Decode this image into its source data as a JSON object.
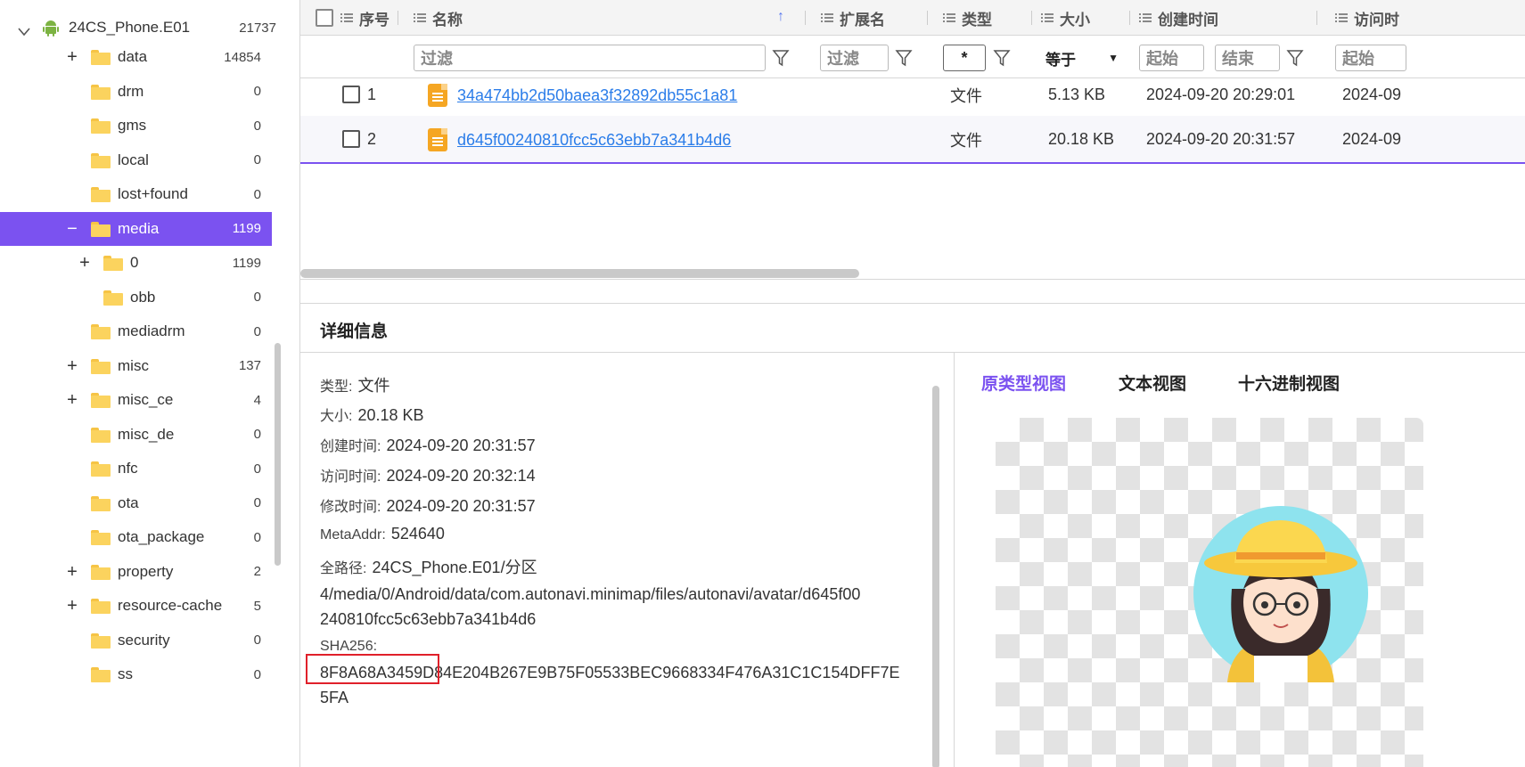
{
  "tree": {
    "root": {
      "label": "24CS_Phone.E01",
      "count": "21737"
    },
    "items": [
      {
        "label": "data",
        "count": "14854",
        "expander": "+"
      },
      {
        "label": "drm",
        "count": "0",
        "expander": ""
      },
      {
        "label": "gms",
        "count": "0",
        "expander": ""
      },
      {
        "label": "local",
        "count": "0",
        "expander": ""
      },
      {
        "label": "lost+found",
        "count": "0",
        "expander": ""
      },
      {
        "label": "media",
        "count": "1199",
        "expander": "−"
      },
      {
        "label": "0",
        "count": "1199",
        "expander": "+"
      },
      {
        "label": "obb",
        "count": "0",
        "expander": ""
      },
      {
        "label": "mediadrm",
        "count": "0",
        "expander": ""
      },
      {
        "label": "misc",
        "count": "137",
        "expander": "+"
      },
      {
        "label": "misc_ce",
        "count": "4",
        "expander": "+"
      },
      {
        "label": "misc_de",
        "count": "0",
        "expander": ""
      },
      {
        "label": "nfc",
        "count": "0",
        "expander": ""
      },
      {
        "label": "ota",
        "count": "0",
        "expander": ""
      },
      {
        "label": "ota_package",
        "count": "0",
        "expander": ""
      },
      {
        "label": "property",
        "count": "2",
        "expander": "+"
      },
      {
        "label": "resource-cache",
        "count": "5",
        "expander": "+"
      },
      {
        "label": "security",
        "count": "0",
        "expander": ""
      },
      {
        "label": "ss",
        "count": "0",
        "expander": ""
      }
    ]
  },
  "table": {
    "headers": {
      "index": "序号",
      "name": "名称",
      "ext": "扩展名",
      "type": "类型",
      "size": "大小",
      "ctime": "创建时间",
      "atime": "访问时"
    },
    "filters": {
      "name_placeholder": "过滤",
      "ext_placeholder": "过滤",
      "type_value": "*",
      "size_op": "等于",
      "ctime_start": "起始",
      "ctime_end": "结束",
      "atime_start": "起始"
    },
    "rows": [
      {
        "index": "1",
        "name": "34a474bb2d50baea3f32892db55c1a81",
        "type": "文件",
        "size": "5.13 KB",
        "ctime": "2024-09-20 20:29:01",
        "atime": "2024-09"
      },
      {
        "index": "2",
        "name": "d645f00240810fcc5c63ebb7a341b4d6",
        "type": "文件",
        "size": "20.18 KB",
        "ctime": "2024-09-20 20:31:57",
        "atime": "2024-09"
      }
    ]
  },
  "detail": {
    "title": "详细信息",
    "type_key": "类型:",
    "type_val": "文件",
    "size_key": "大小:",
    "size_val": "20.18 KB",
    "ctime_key": "创建时间:",
    "ctime_val": "2024-09-20 20:31:57",
    "atime_key": "访问时间:",
    "atime_val": "2024-09-20 20:32:14",
    "mtime_key": "修改时间:",
    "mtime_val": "2024-09-20 20:31:57",
    "meta_key": "MetaAddr:",
    "meta_val": "524640",
    "path_key": "全路径:",
    "path_line1": "24CS_Phone.E01/分区",
    "path_line2": "4/media/0/Android/data/com.autonavi.minimap/files/autonavi/avatar/d645f00",
    "path_line3": "240810fcc5c63ebb7a341b4d6",
    "sha_key": "SHA256:",
    "sha_line1": "8F8A68A3459D84E204B267E9B75F05533BEC9668334F476A31C1C154DFF7E",
    "sha_line2": "5FA",
    "tabs": [
      "原类型视图",
      "文本视图",
      "十六进制视图"
    ]
  },
  "colors": {
    "accent": "#7b52f0",
    "link": "#2b7de9",
    "highlight_box": "#e0202a",
    "folder": "#fbd35e",
    "file": "#f5a623"
  }
}
